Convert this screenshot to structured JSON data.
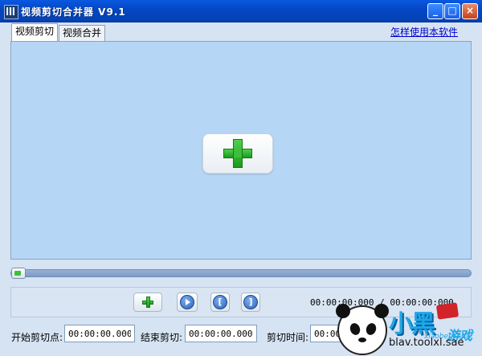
{
  "window": {
    "title": "视频剪切合并器 V9.1",
    "min_glyph": "_",
    "max_glyph": "□",
    "close_glyph": "×"
  },
  "tabs": [
    {
      "label": "视频剪切",
      "active": true
    },
    {
      "label": "视频合并",
      "active": false
    }
  ],
  "help_link": "怎样使用本软件",
  "player": {
    "progress": 0.0,
    "time_display": "00:00:00:000 / 00:00:00:000"
  },
  "bracket_start": "[",
  "bracket_end": "]",
  "cut": {
    "start_label": "开始剪切点:",
    "start_value": "00:00:00.000",
    "end_label": "结束剪切:",
    "end_value": "00:00:00.000",
    "duration_label": "剪切时间:",
    "duration_value": "00:00:00.000"
  },
  "watermark": {
    "big": "小黑",
    "game": "游戏",
    "domain": "blav.toolxl.sae",
    "sub": "xiaohei.com"
  },
  "icons": {
    "add": "plus-icon",
    "play": "play-icon",
    "mark_start": "mark-start-icon",
    "mark_end": "mark-end-icon"
  },
  "colors": {
    "titlebar": "#0447c4",
    "video_bg": "#b6d6f6",
    "plus_green": "#1d9a1d",
    "link": "#0000cc"
  }
}
